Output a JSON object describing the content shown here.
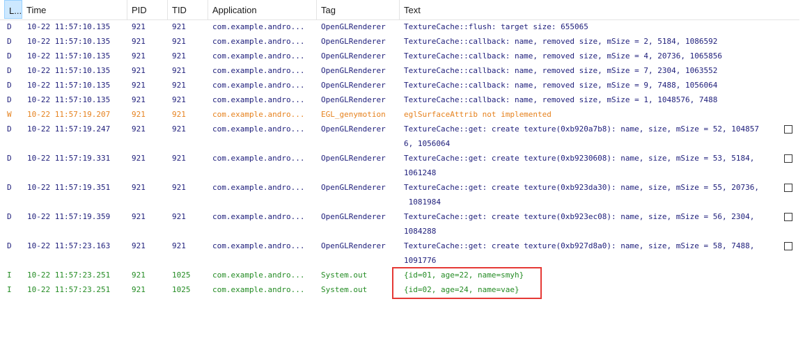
{
  "columns": {
    "level": "L...",
    "time": "Time",
    "pid": "PID",
    "tid": "TID",
    "application": "Application",
    "tag": "Tag",
    "text": "Text"
  },
  "colors": {
    "debug": "#1d1d7a",
    "warn": "#e6821e",
    "info": "#238b23",
    "header_selected": "#cde8ff",
    "highlight_border": "#e53935"
  },
  "rows": [
    {
      "level": "D",
      "time": "10-22 11:57:10.135",
      "pid": "921",
      "tid": "921",
      "app": "com.example.andro...",
      "tag": "OpenGLRenderer",
      "lines": [
        "TextureCache::flush: target size: 655065"
      ]
    },
    {
      "level": "D",
      "time": "10-22 11:57:10.135",
      "pid": "921",
      "tid": "921",
      "app": "com.example.andro...",
      "tag": "OpenGLRenderer",
      "lines": [
        "TextureCache::callback: name, removed size, mSize = 2, 5184, 1086592"
      ]
    },
    {
      "level": "D",
      "time": "10-22 11:57:10.135",
      "pid": "921",
      "tid": "921",
      "app": "com.example.andro...",
      "tag": "OpenGLRenderer",
      "lines": [
        "TextureCache::callback: name, removed size, mSize = 4, 20736, 1065856"
      ]
    },
    {
      "level": "D",
      "time": "10-22 11:57:10.135",
      "pid": "921",
      "tid": "921",
      "app": "com.example.andro...",
      "tag": "OpenGLRenderer",
      "lines": [
        "TextureCache::callback: name, removed size, mSize = 7, 2304, 1063552"
      ]
    },
    {
      "level": "D",
      "time": "10-22 11:57:10.135",
      "pid": "921",
      "tid": "921",
      "app": "com.example.andro...",
      "tag": "OpenGLRenderer",
      "lines": [
        "TextureCache::callback: name, removed size, mSize = 9, 7488, 1056064"
      ]
    },
    {
      "level": "D",
      "time": "10-22 11:57:10.135",
      "pid": "921",
      "tid": "921",
      "app": "com.example.andro...",
      "tag": "OpenGLRenderer",
      "lines": [
        "TextureCache::callback: name, removed size, mSize = 1, 1048576, 7488"
      ]
    },
    {
      "level": "W",
      "time": "10-22 11:57:19.207",
      "pid": "921",
      "tid": "921",
      "app": "com.example.andro...",
      "tag": "EGL_genymotion",
      "lines": [
        "eglSurfaceAttrib not implemented"
      ]
    },
    {
      "level": "D",
      "time": "10-22 11:57:19.247",
      "pid": "921",
      "tid": "921",
      "app": "com.example.andro...",
      "tag": "OpenGLRenderer",
      "lines": [
        "TextureCache::get: create texture(0xb920a7b8): name, size, mSize = 52, 104857",
        "6, 1056064"
      ]
    },
    {
      "level": "D",
      "time": "10-22 11:57:19.331",
      "pid": "921",
      "tid": "921",
      "app": "com.example.andro...",
      "tag": "OpenGLRenderer",
      "lines": [
        "TextureCache::get: create texture(0xb9230608): name, size, mSize = 53, 5184, ",
        "1061248"
      ]
    },
    {
      "level": "D",
      "time": "10-22 11:57:19.351",
      "pid": "921",
      "tid": "921",
      "app": "com.example.andro...",
      "tag": "OpenGLRenderer",
      "lines": [
        "TextureCache::get: create texture(0xb923da30): name, size, mSize = 55, 20736,",
        " 1081984"
      ]
    },
    {
      "level": "D",
      "time": "10-22 11:57:19.359",
      "pid": "921",
      "tid": "921",
      "app": "com.example.andro...",
      "tag": "OpenGLRenderer",
      "lines": [
        "TextureCache::get: create texture(0xb923ec08): name, size, mSize = 56, 2304, ",
        "1084288"
      ]
    },
    {
      "level": "D",
      "time": "10-22 11:57:23.163",
      "pid": "921",
      "tid": "921",
      "app": "com.example.andro...",
      "tag": "OpenGLRenderer",
      "lines": [
        "TextureCache::get: create texture(0xb927d8a0): name, size, mSize = 58, 7488, ",
        "1091776"
      ]
    },
    {
      "level": "I",
      "time": "10-22 11:57:23.251",
      "pid": "921",
      "tid": "1025",
      "app": "com.example.andro...",
      "tag": "System.out",
      "lines": [
        "{id=01, age=22, name=smyh}"
      ]
    },
    {
      "level": "I",
      "time": "10-22 11:57:23.251",
      "pid": "921",
      "tid": "1025",
      "app": "com.example.andro...",
      "tag": "System.out",
      "lines": [
        "{id=02, age=24, name=vae}"
      ]
    }
  ]
}
